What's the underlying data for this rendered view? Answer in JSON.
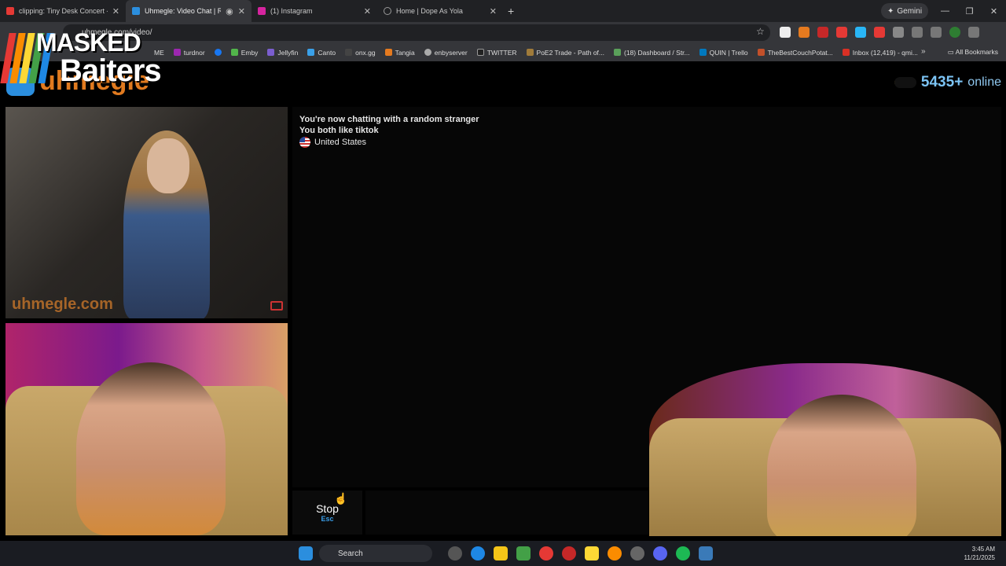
{
  "browser": {
    "tabs": [
      {
        "label": "clipping: Tiny Desk Concert - Y",
        "color": "#e53935",
        "active": false
      },
      {
        "label": "Uhmegle: Video Chat | Ran",
        "color": "#2b8ede",
        "active": true
      },
      {
        "label": "(1) Instagram",
        "color": "#d6249f",
        "active": false
      },
      {
        "label": "Home | Dope As Yola",
        "color": "#777777",
        "active": false
      }
    ],
    "new_tab": "+",
    "gemini_label": "Gemini",
    "url": "uhmegle.com/video/",
    "bookmarks": [
      {
        "label": "ME",
        "color": "#888888"
      },
      {
        "label": "turdnor",
        "color": "#9c27b0"
      },
      {
        "label": "",
        "color": "#1877f2"
      },
      {
        "label": "Emby",
        "color": "#52b54b"
      },
      {
        "label": "Jellyfin",
        "color": "#7b5ecf"
      },
      {
        "label": "Canto",
        "color": "#3aa0e8"
      },
      {
        "label": "onx.gg",
        "color": "#444444"
      },
      {
        "label": "Tangia",
        "color": "#e57a1f"
      },
      {
        "label": "enbyserver",
        "color": "#aaaaaa"
      },
      {
        "label": "TWITTER",
        "color": "#222222"
      },
      {
        "label": "PoE2 Trade - Path of...",
        "color": "#a07b3a"
      },
      {
        "label": "(18) Dashboard / Str...",
        "color": "#5aa05a"
      },
      {
        "label": "QUIN | Trello",
        "color": "#0079bf"
      },
      {
        "label": "TheBestCouchPotat...",
        "color": "#c2502a"
      },
      {
        "label": "Inbox (12,419) - qmi...",
        "color": "#d93025"
      }
    ],
    "all_bookmarks": "All Bookmarks"
  },
  "watermark": {
    "line1": "MASKED",
    "line2": "Baiters"
  },
  "app": {
    "brand": "uhmegle",
    "online_count": "5435+",
    "online_label": "online"
  },
  "chat": {
    "line1": "You're now chatting with a random stranger",
    "line2": "You both like tiktok",
    "country": "United States"
  },
  "video_watermark": "uhmegle.com",
  "controls": {
    "stop_label": "Stop",
    "stop_key": "Esc"
  },
  "taskbar": {
    "search": "Search",
    "time": "3:45 AM",
    "date": "11/21/2025"
  }
}
